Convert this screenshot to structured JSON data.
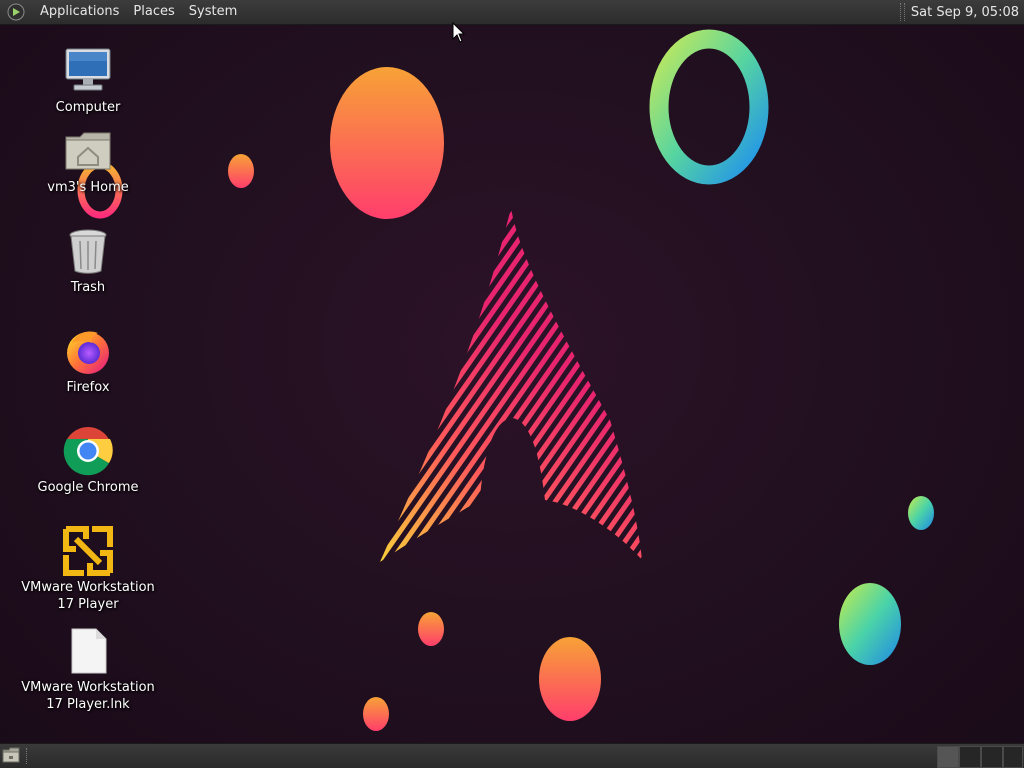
{
  "top_panel": {
    "menus": [
      "Applications",
      "Places",
      "System"
    ],
    "clock": "Sat Sep  9, 05:08"
  },
  "desktop_icons": [
    {
      "label": "Computer",
      "icon": "computer-icon"
    },
    {
      "label": "vm3's Home",
      "icon": "home-folder-icon"
    },
    {
      "label": "Trash",
      "icon": "trash-icon"
    },
    {
      "label": "Firefox",
      "icon": "firefox-icon"
    },
    {
      "label": "Google Chrome",
      "icon": "chrome-icon"
    },
    {
      "label": "VMware Workstation\n17 Player",
      "icon": "vmware-icon"
    },
    {
      "label": "VMware Workstation\n17 Player.lnk",
      "icon": "file-icon"
    }
  ],
  "colors": {
    "panel": "#333333",
    "desktop_background": "#221020",
    "arch_logo_pink": "#e8246e",
    "arch_logo_yellow": "#f7d23a"
  }
}
